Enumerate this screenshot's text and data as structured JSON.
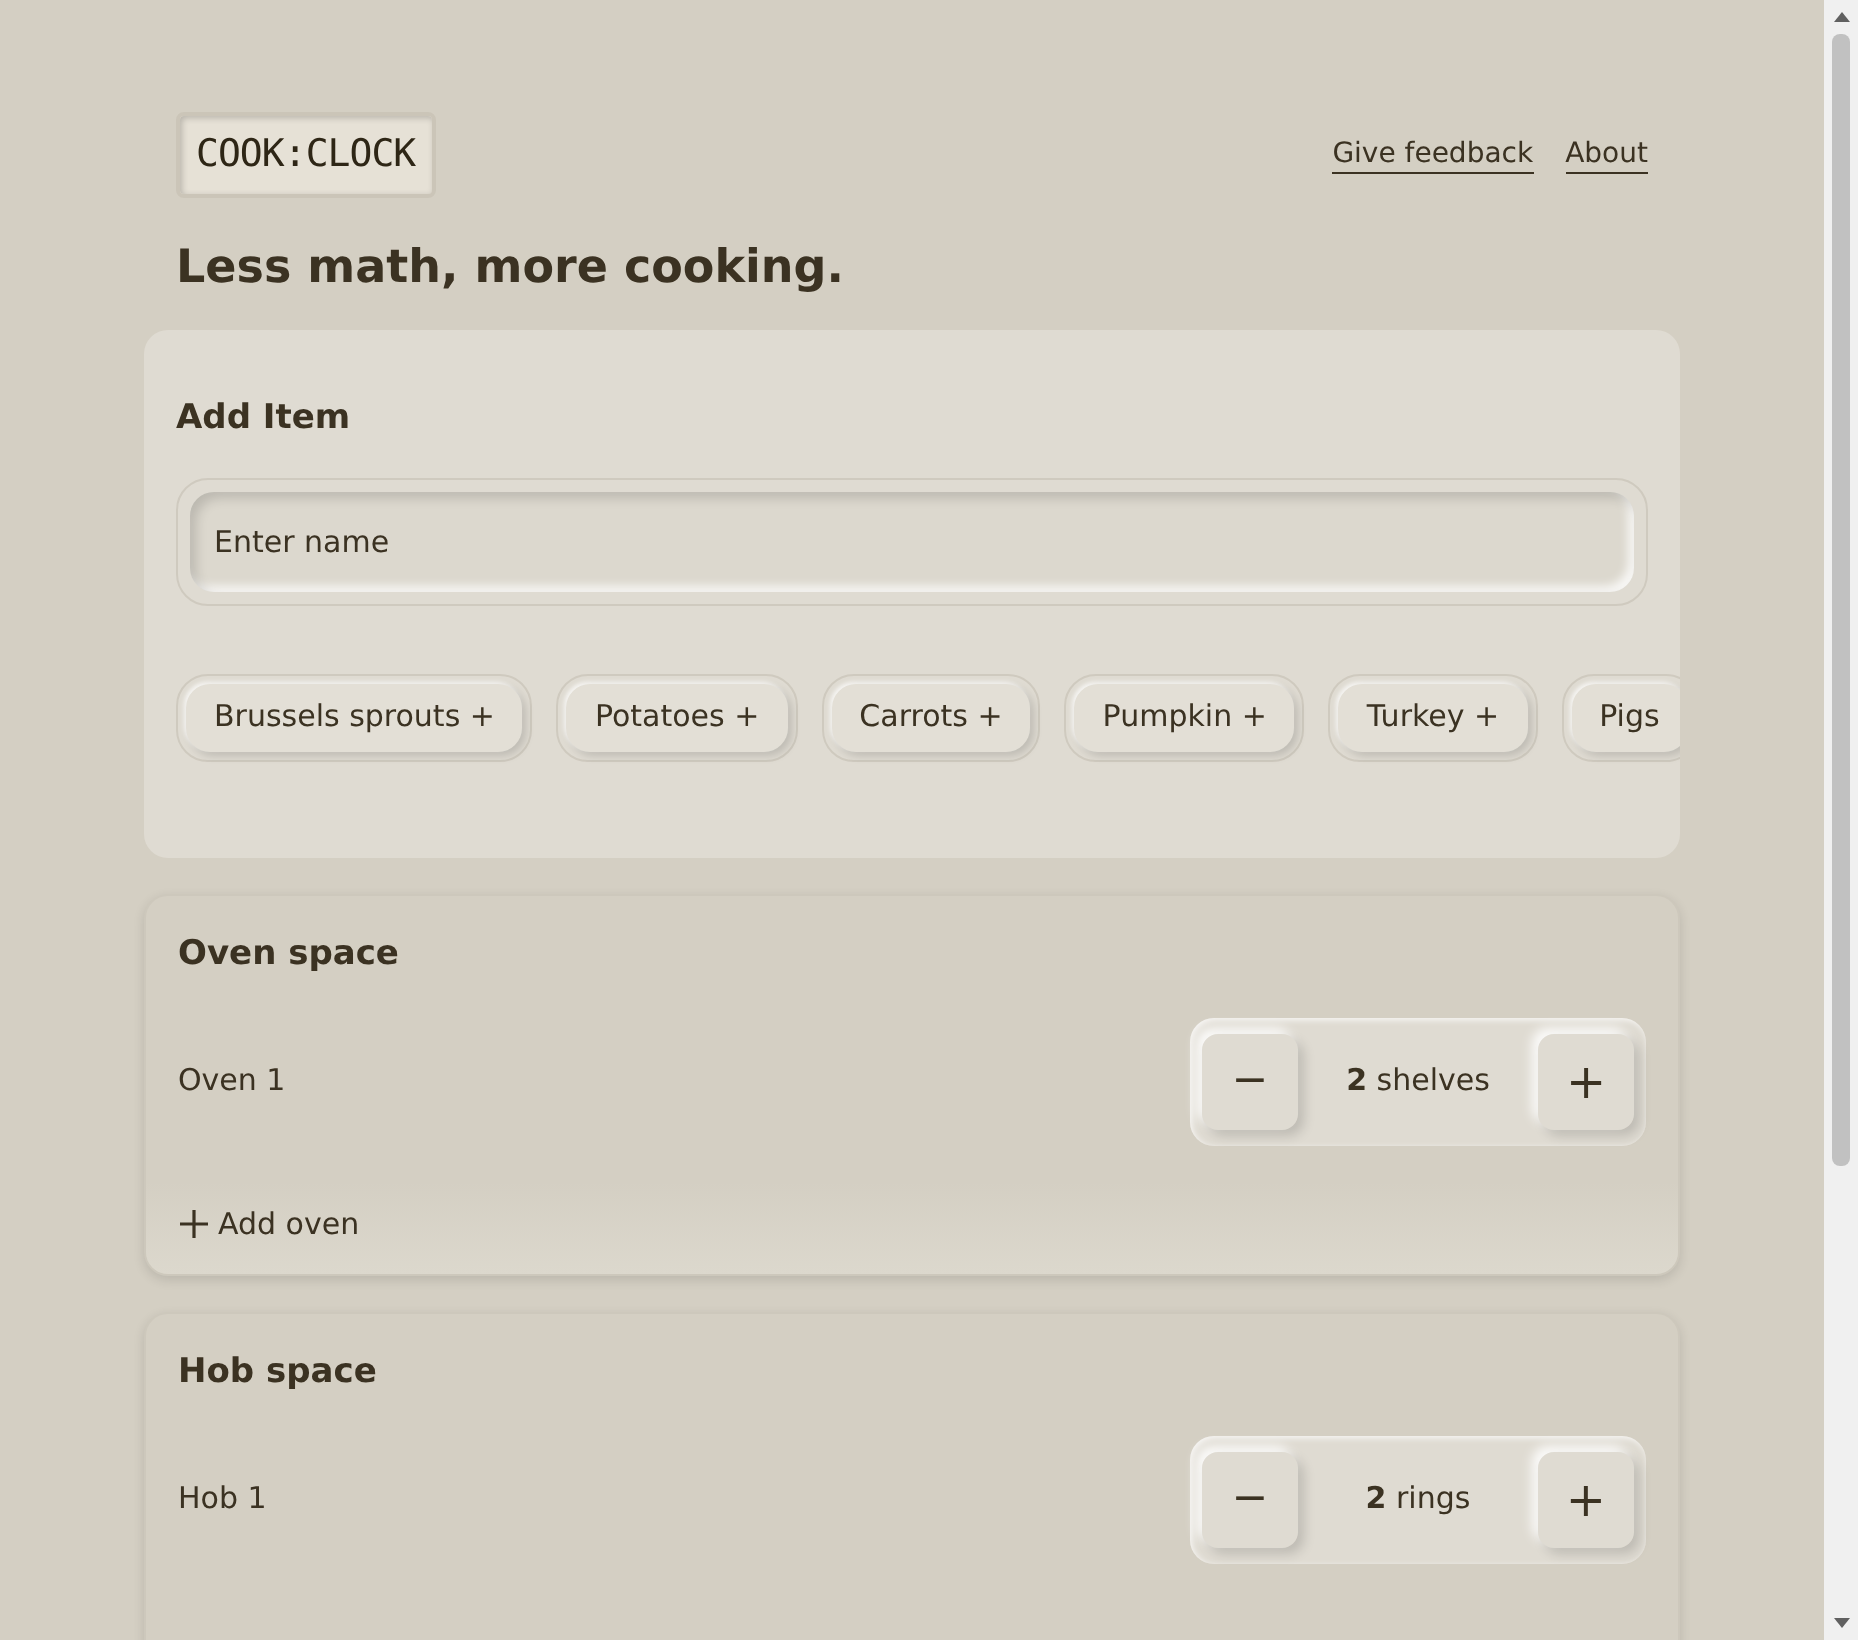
{
  "header": {
    "logo": "COOK:CLOCK",
    "links": [
      "Give feedback",
      "About"
    ]
  },
  "tagline": "Less math, more cooking.",
  "add_item": {
    "title": "Add Item",
    "input": {
      "placeholder": "Enter name"
    },
    "suggestions": [
      "Brussels sprouts +",
      "Potatoes +",
      "Carrots +",
      "Pumpkin +",
      "Turkey +",
      "Pigs"
    ]
  },
  "sections": [
    {
      "title": "Oven space",
      "rows": [
        {
          "name": "Oven 1",
          "value": "**2** shelves",
          "minus": "−",
          "plus": "+"
        }
      ],
      "add_label": "Add oven"
    },
    {
      "title": "Hob space",
      "rows": [
        {
          "name": "Hob 1",
          "value": "**2** rings",
          "minus": "−",
          "plus": "+"
        }
      ]
    }
  ]
}
